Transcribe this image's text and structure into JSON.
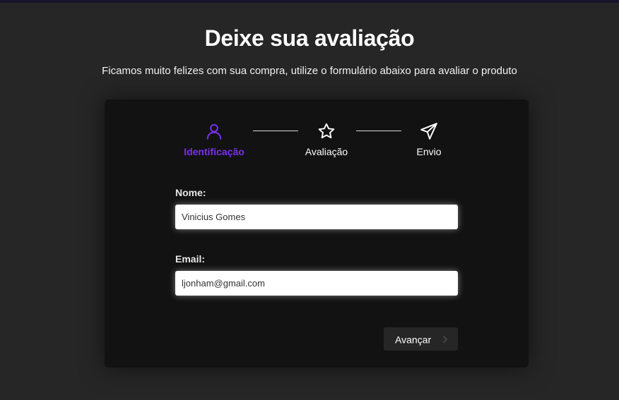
{
  "page": {
    "title": "Deixe sua avaliação",
    "subtitle": "Ficamos muito felizes com sua compra, utilize o formulário abaixo para avaliar o produto"
  },
  "steps": [
    {
      "label": "Identificação",
      "icon": "user-icon",
      "active": true
    },
    {
      "label": "Avaliação",
      "icon": "star-icon",
      "active": false
    },
    {
      "label": "Envio",
      "icon": "send-icon",
      "active": false
    }
  ],
  "form": {
    "name": {
      "label": "Nome:",
      "value": "Vinicius Gomes"
    },
    "email": {
      "label": "Email:",
      "value": "ljonham@gmail.com"
    }
  },
  "actions": {
    "next_label": "Avançar",
    "next_icon": "chevron-right-icon"
  },
  "colors": {
    "background": "#262626",
    "card": "#121212",
    "accent": "#7a2ff0",
    "text": "#ffffff",
    "button_bg": "#262626"
  }
}
